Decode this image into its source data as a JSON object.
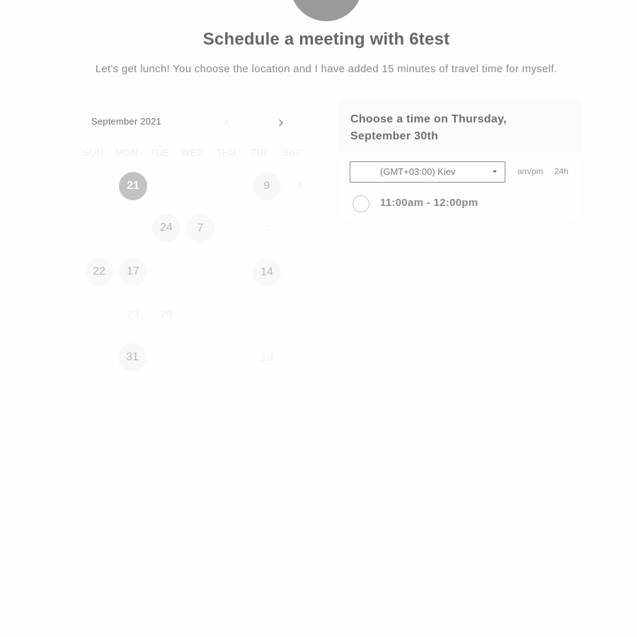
{
  "header": {
    "title": "Schedule a meeting with 6test",
    "description": "Let's get lunch! You choose the location and I have added 15 minutes of travel time for myself."
  },
  "calendar": {
    "month_label": "September 2021",
    "prev_icon": "‹",
    "next_icon": "›",
    "weekdays": [
      "SUN",
      "MON",
      "TUE",
      "WED",
      "THU",
      "FRI",
      "SAT"
    ],
    "days": {
      "d21": "21",
      "d9": "9",
      "d5": "5",
      "d24": "24",
      "d7": "7",
      "d1": "1",
      "d22": "22",
      "d17": "17",
      "d14": "14",
      "d23": "23",
      "d28": "28",
      "d31": "31",
      "d19": "19"
    }
  },
  "time_panel": {
    "heading": "Choose a time on Thursday, September 30th",
    "timezone": "(GMT+03:00) Kiev",
    "format_ampm": "am/pm",
    "format_24h": "24h",
    "slots": [
      "11:00am - 12:00pm"
    ]
  },
  "colors": {
    "selected_day": "#c2c2c2",
    "available_day": "#f8f8f8",
    "avatar": "#9a9a9a"
  }
}
